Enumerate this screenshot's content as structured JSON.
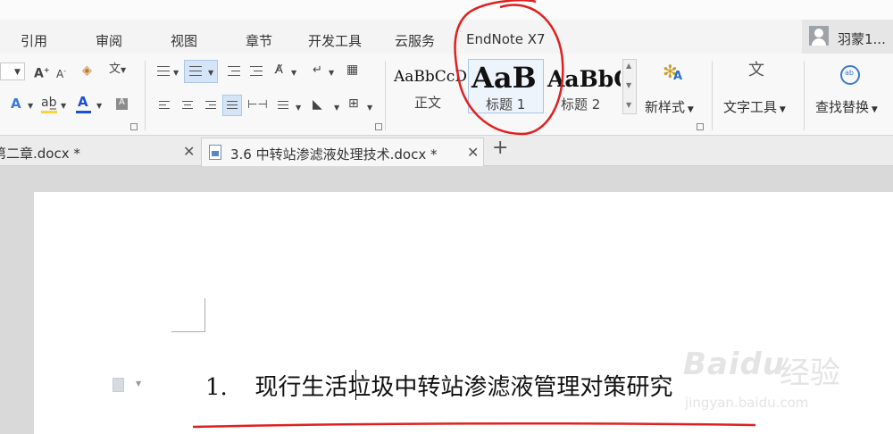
{
  "menu": {
    "items": [
      "引用",
      "审阅",
      "视图",
      "章节",
      "开发工具",
      "云服务",
      "EndNote X7"
    ],
    "user_name": "羽蒙1..."
  },
  "ribbon": {
    "font_buttons": {
      "grow": "A⁺",
      "shrink": "A⁻",
      "clear": "◈",
      "phonetic": "文"
    },
    "styles": [
      {
        "sample": "AaBbCcD",
        "name": "正文"
      },
      {
        "sample": "AaB",
        "name": "标题 1"
      },
      {
        "sample": "AaBbC",
        "name": "标题 2"
      }
    ],
    "new_style": "新样式",
    "text_tools": "文字工具",
    "find_replace": "查找替换",
    "accent_color": "#3a7bd5",
    "font_color_bar": "#1a4fd6",
    "highlight_bar": "#f5d63b"
  },
  "tabs": [
    {
      "label": "第二章.docx *",
      "active": false
    },
    {
      "label": "3.6 中转站渗滤液处理技术.docx *",
      "active": true
    }
  ],
  "new_tab_label": "+",
  "document": {
    "heading_number": "1.",
    "heading_text": "现行生活垃圾中转站渗滤液管理对策研究"
  },
  "annotation_color": "#e02020",
  "watermark": {
    "brand": "Baidu",
    "cn": "经验",
    "url": "jingyan.baidu.com"
  }
}
